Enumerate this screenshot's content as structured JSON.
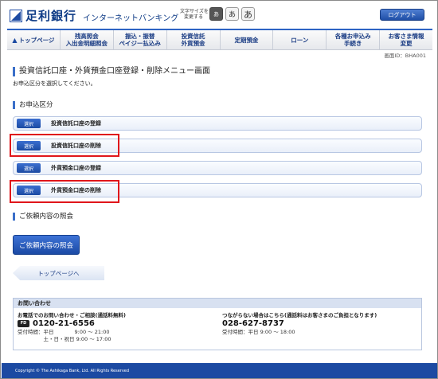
{
  "header": {
    "bank_name": "足利銀行",
    "service_name": "インターネットバンキング",
    "font_size_label": "文字サイズを\n変更する",
    "font_size_options": [
      "あ",
      "あ",
      "あ"
    ],
    "logout_label": "ログアウト"
  },
  "nav": {
    "home_icon": "▲",
    "items": [
      "トップページ",
      "残高照会\n入出金明細照会",
      "振込・振替\nペイジー払込み",
      "投資信託\n外貨預金",
      "定期預金",
      "ローン",
      "各種お申込み\n手続き",
      "お客さま情報\n変更"
    ]
  },
  "screen_id": "画面ID：BHA001",
  "main": {
    "title": "投資信託口座・外貨預金口座登録・削除メニュー画面",
    "instruction": "お申込区分を選択してください。",
    "section_apply": "お申込区分",
    "select_label": "選択",
    "options": [
      "投資信託口座の登録",
      "投資信託口座の削除",
      "外貨預金口座の登録",
      "外貨預金口座の削除"
    ],
    "section_inquiry": "ご依頼内容の照会",
    "inquiry_button": "ご依頼内容の照会",
    "top_link": "トップページへ"
  },
  "contact": {
    "heading": "お問い合わせ",
    "left_title": "お電話でのお問い合わせ・ご相談(通話料無料)",
    "left_icon": "FD",
    "left_phone": "0120-21-6556",
    "left_hours": "受付時間：平日　　　　9:00 ～ 21:00\n　　　　　土・日・祝日 9:00 ～ 17:00",
    "right_title": "つながらない場合はこちら(通話料はお客さまのご負担となります)",
    "right_phone": "028-627-8737",
    "right_hours": "受付時間：平日 9:00 ～ 18:00"
  },
  "footer": {
    "copyright": "Copyright © The Ashikaga Bank, Ltd. All Rights Reserved"
  },
  "colors": {
    "brand_blue": "#1c4aa2",
    "highlight_red": "#e0161b"
  }
}
